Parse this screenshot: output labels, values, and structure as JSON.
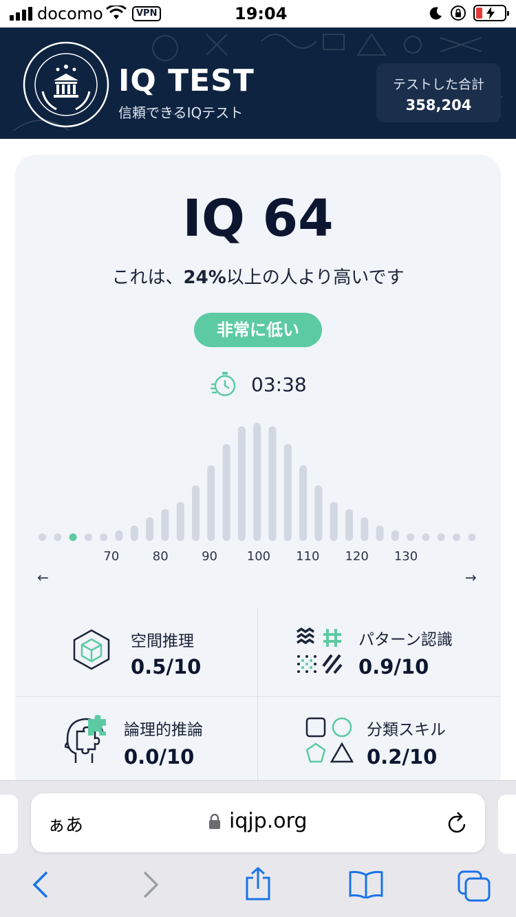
{
  "status_bar": {
    "carrier": "docomo",
    "vpn": "VPN",
    "time": "19:04"
  },
  "header": {
    "title": "IQ TEST",
    "subtitle": "信頼できるIQテスト",
    "count_label": "テストした合計",
    "count_value": "358,204",
    "logo_text": "信頼できる IQ テスト"
  },
  "result": {
    "iq": "IQ 64",
    "compare_prefix": "これは、",
    "compare_percent": "24%",
    "compare_suffix": "以上の人より高いです",
    "badge": "非常に低い",
    "time": "03:38"
  },
  "distribution": {
    "arrow_left": "←",
    "arrow_right": "→",
    "highlight_index": 2,
    "highlight_color": "#5ccaa3",
    "bar_color": "#d2d8e2",
    "tick_labels": [
      "70",
      "80",
      "90",
      "100",
      "110",
      "120",
      "130"
    ],
    "bar_levels": [
      0.03,
      0.03,
      0.03,
      0.04,
      0.05,
      0.09,
      0.13,
      0.2,
      0.27,
      0.33,
      0.47,
      0.64,
      0.82,
      0.97,
      1.0,
      0.97,
      0.82,
      0.64,
      0.47,
      0.33,
      0.27,
      0.2,
      0.13,
      0.09,
      0.05,
      0.04,
      0.03,
      0.03,
      0.03
    ]
  },
  "stats": [
    {
      "name": "空間推理",
      "score": "0.5/10",
      "icon": "cube-icon"
    },
    {
      "name": "パターン認識",
      "score": "0.9/10",
      "icon": "pattern-icon"
    },
    {
      "name": "論理的推論",
      "score": "0.0/10",
      "icon": "puzzle-head-icon"
    },
    {
      "name": "分類スキル",
      "score": "0.2/10",
      "icon": "shapes-icon"
    }
  ],
  "browser": {
    "aa": "ぁあ",
    "url": "iqjp.org"
  },
  "colors": {
    "header_bg": "#0e2340",
    "accent": "#5ccaa3",
    "card_bg": "#f1f4f8",
    "ios_blue": "#1a73e8"
  }
}
